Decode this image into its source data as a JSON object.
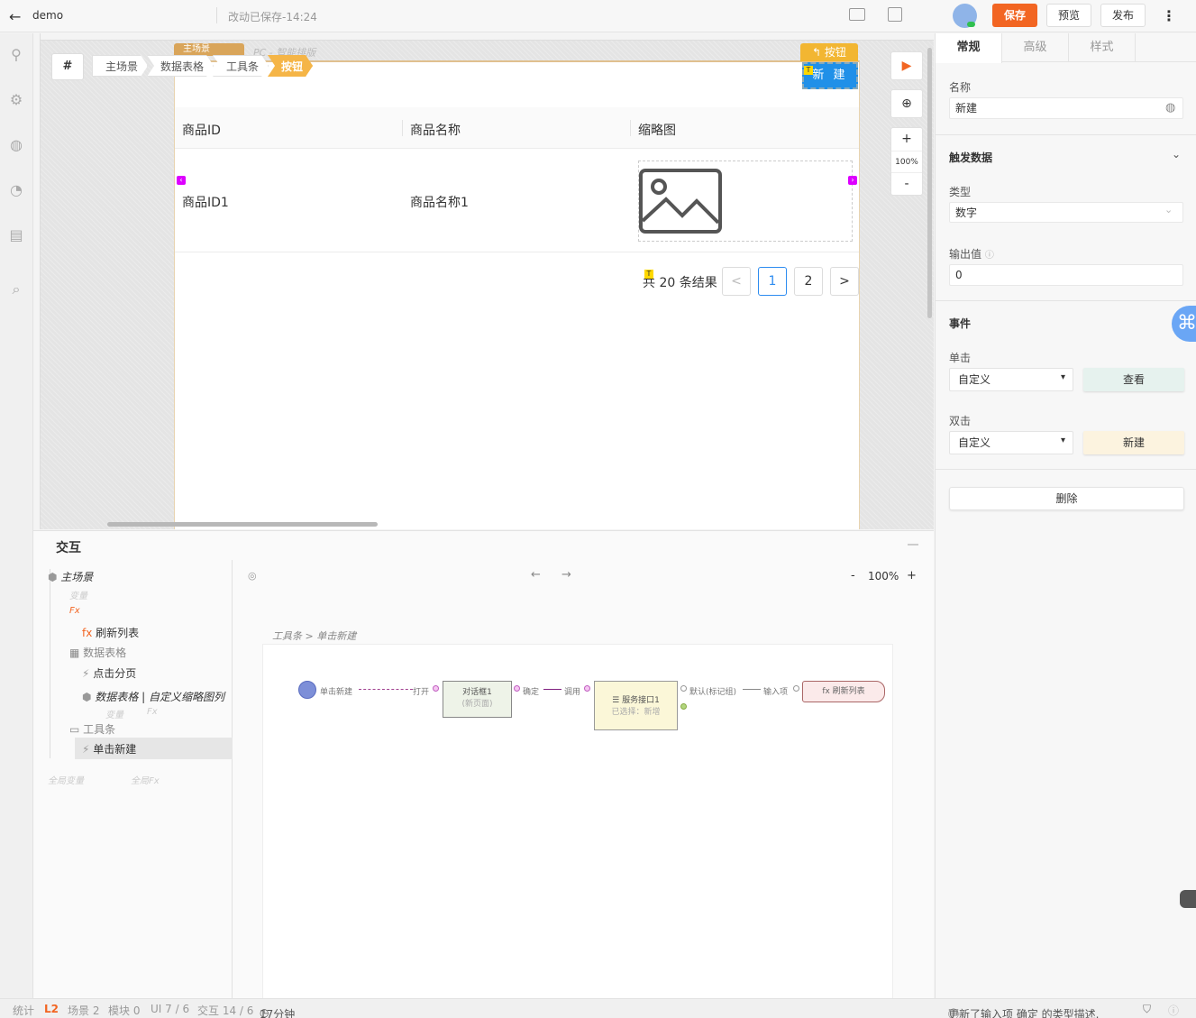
{
  "topbar": {
    "project": "demo",
    "saved": "改动已保存-14:24",
    "save": "保存",
    "preview": "预览",
    "publish": "发布"
  },
  "canvas": {
    "hash": "#",
    "breadcrumbs": [
      "主场景",
      "数据表格",
      "工具条",
      "按钮"
    ],
    "scene_tab": "主场景",
    "scene_sub": "PC - 智能排版",
    "toolbar_label": "按钮",
    "new_button": "新 建",
    "table": {
      "columns": [
        "商品ID",
        "商品名称",
        "缩略图"
      ],
      "row": [
        "商品ID1",
        "商品名称1"
      ]
    },
    "pager": {
      "total": "共 20 条结果",
      "prev": "<",
      "pages": [
        "1",
        "2"
      ],
      "next": ">",
      "current": 1
    },
    "zoom": "100%",
    "zoom_in": "+",
    "zoom_out": "-"
  },
  "interaction": {
    "title": "交互",
    "tree": {
      "main_scene": "主场景",
      "var": "变量",
      "fx": "Fx",
      "refresh_list": "刷新列表",
      "data_table": "数据表格",
      "click_page": "点击分页",
      "custom_col": "数据表格 | 自定义缩略图列",
      "var2": "变量",
      "fx2": "Fx",
      "toolbar": "工具条",
      "click_new": "单击新建",
      "global_var": "全局变量",
      "global_fx": "全局Fx"
    },
    "zoom": "100%",
    "zoom_minus": "-",
    "zoom_plus": "+",
    "path": "工具条 > 单击新建",
    "flow": {
      "start": "单击新建",
      "open": "打开",
      "dialog": "对话框1",
      "dialog_sub": "(新页面)",
      "confirm": "确定",
      "invoke": "调用",
      "service": "服务接口1",
      "service_sub": "已选择：新增",
      "default": "默认(标记组)",
      "input": "输入项",
      "refresh": "fx 刷新列表"
    }
  },
  "right": {
    "tabs": [
      "常规",
      "高级",
      "样式"
    ],
    "name_label": "名称",
    "name_value": "新建",
    "trigger_section": "触发数据",
    "type_label": "类型",
    "type_value": "数字",
    "output_label": "输出值",
    "output_value": "0",
    "event_section": "事件",
    "click_label": "单击",
    "click_select": "自定义",
    "click_btn": "查看",
    "dblclick_label": "双击",
    "dblclick_select": "自定义",
    "dblclick_btn": "新建",
    "delete": "删除",
    "colors": {
      "view_btn": "#e6f2ee",
      "new_btn": "#fcf3df"
    }
  },
  "status": {
    "stats": "统计",
    "level": "L2",
    "scenes": "场景 2",
    "modules": "模块 0",
    "ui": "UI 7 / 6",
    "interact": "交互 14 / 6",
    "time": "17分钟",
    "message": "更新了输入项 确定 的类型描述."
  },
  "accent": "#f26522"
}
